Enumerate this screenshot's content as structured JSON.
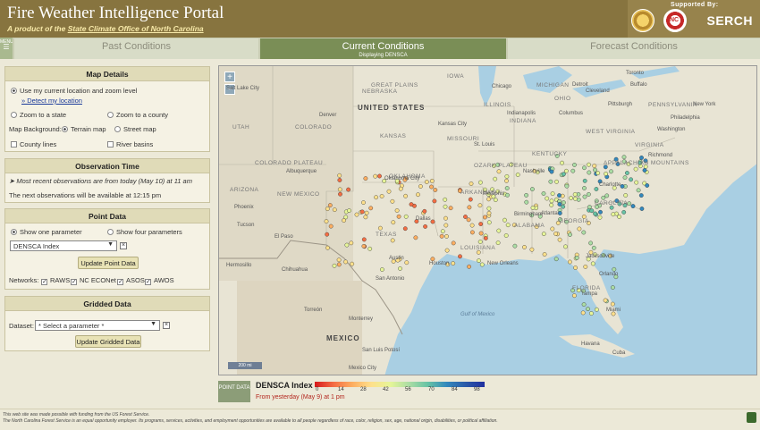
{
  "header": {
    "title": "Fire Weather Intelligence Portal",
    "subtitle_prefix": "A product of the ",
    "subtitle_link": "State Climate Office of North Carolina",
    "supported_by": "Supported By:",
    "seal2_text": "NC",
    "serch": "SERCH"
  },
  "menu": {
    "label": "MENU",
    "icon": "☰"
  },
  "tabs": [
    {
      "label": "Past Conditions",
      "sub": ""
    },
    {
      "label": "Current Conditions",
      "sub": "Displaying DENSCA"
    },
    {
      "label": "Forecast Conditions",
      "sub": ""
    }
  ],
  "map_details": {
    "heading": "Map Details",
    "use_location": "Use my current location and zoom level",
    "detect_link": "» Detect my location",
    "zoom_state": "Zoom to a state",
    "zoom_county": "Zoom to a county",
    "background_label": "Map Background:",
    "terrain": "Terrain map",
    "street": "Street map",
    "county_lines": "County lines",
    "river_basins": "River basins"
  },
  "observation_time": {
    "heading": "Observation Time",
    "recent": "➤ Most recent observations are from today (May 10) at 11 am",
    "next": "The next observations will be available at 12:15 pm"
  },
  "point_data": {
    "heading": "Point Data",
    "show_one": "Show one parameter",
    "show_four": "Show four parameters",
    "selected_param": "DENSCA Index",
    "update_btn": "Update Point Data",
    "networks_label": "Networks:",
    "networks": [
      "RAWS",
      "NC ECONet",
      "ASOS",
      "AWOS"
    ]
  },
  "gridded_data": {
    "heading": "Gridded Data",
    "dataset_label": "Dataset:",
    "dataset_value": "* Select a parameter *",
    "update_btn": "Update Gridded Data"
  },
  "map": {
    "zoom_in": "+",
    "zoom_out": "−",
    "scale": "200 mi",
    "country_us": "UNITED STATES",
    "country_mx": "MEXICO",
    "great_plains": "GREAT PLAINS",
    "states": [
      "NEBRASKA",
      "COLORADO",
      "KANSAS",
      "MISSOURI",
      "ILLINOIS",
      "KENTUCKY",
      "ARIZONA",
      "NEW MEXICO",
      "TEXAS",
      "OKLAHOMA",
      "ARKANSAS",
      "LOUISIANA",
      "ALABAMA",
      "GEORGIA",
      "IOWA",
      "OHIO",
      "INDIANA",
      "WEST VIRGINIA",
      "VIRGINIA",
      "CAROLINA",
      "PENNSYLVANIA",
      "UTAH",
      "FLORIDA",
      "MICHIGAN"
    ],
    "cities": [
      "Denver",
      "Kansas City",
      "Chicago",
      "Indianapolis",
      "St. Louis",
      "Columbus",
      "Pittsburgh",
      "Detroit",
      "Toronto",
      "Buffalo",
      "Cleveland",
      "New York",
      "Philadelphia",
      "Washington",
      "Richmond",
      "Nashville",
      "Atlanta",
      "Charlotte",
      "Memphis",
      "Birmingham",
      "Dallas",
      "Houston",
      "San Antonio",
      "Austin",
      "El Paso",
      "Phoenix",
      "Tucson",
      "Albuquerque",
      "Oklahoma City",
      "New Orleans",
      "Jacksonville",
      "Tampa",
      "Orlando",
      "Miami",
      "Havana",
      "Monterrey",
      "Chihuahua",
      "Hermosillo",
      "Torreón",
      "San Luis Potosí",
      "Mexico City",
      "Salt Lake City",
      "Memphis"
    ],
    "features": [
      "Gulf of Mexico",
      "COLORADO PLATEAU",
      "OZARK PLATEAU",
      "APPALACHIAN MOUNTAINS",
      "Cuba"
    ]
  },
  "legend": {
    "badge": "POINT DATA",
    "title": "DENSCA Index",
    "ticks": [
      "0",
      "14",
      "28",
      "42",
      "56",
      "70",
      "84",
      "98"
    ],
    "from": "From yesterday (May 9) at 1 pm"
  },
  "footer": {
    "line1": "This web site was made possible with funding from the US Forest Service.",
    "line2": "The North Carolina Forest Service is an equal opportunity employer. Its programs, services, activities, and employment opportunities are available to all people regardless of race, color, religion, sex, age, national origin, disabilities, or political affiliation."
  }
}
